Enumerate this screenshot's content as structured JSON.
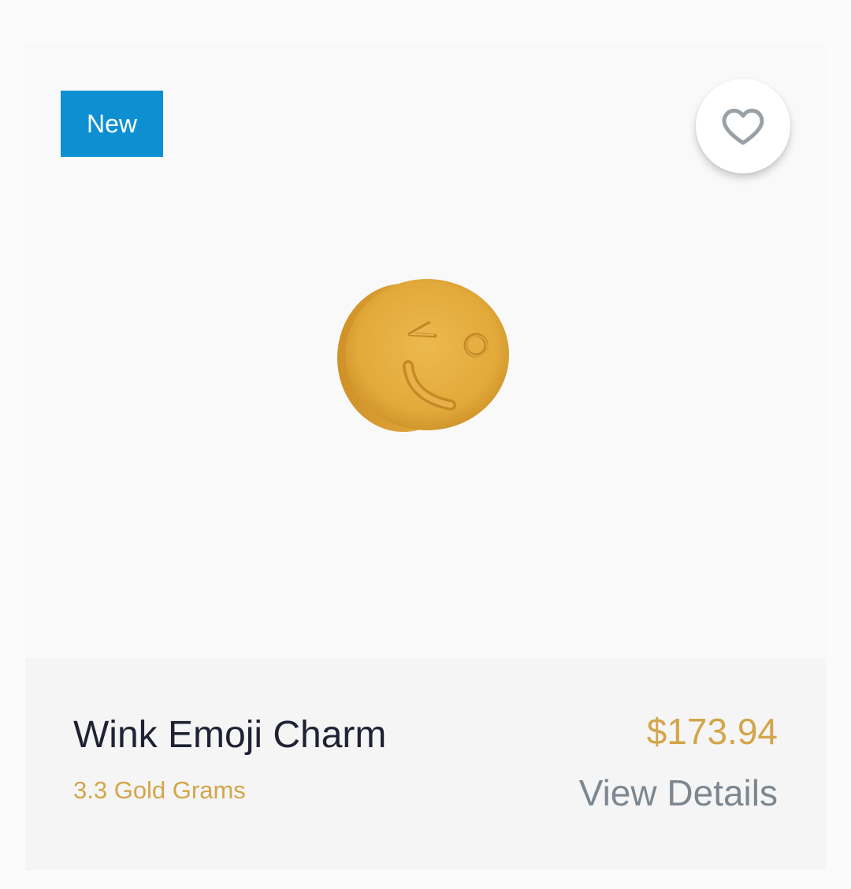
{
  "product": {
    "badge": "New",
    "name": "Wink Emoji Charm",
    "gold_grams": "3.3 Gold Grams",
    "price": "$173.94",
    "view_details": "View Details",
    "image_subject": "gold wink emoji charm bead"
  },
  "icons": {
    "favorite": "heart-outline-icon"
  },
  "colors": {
    "badge_bg": "#0d8fd2",
    "gold_accent": "#d4a54a",
    "title_text": "#1f2233",
    "secondary_text": "#7d8790",
    "heart_outline": "#9aa1a6"
  }
}
